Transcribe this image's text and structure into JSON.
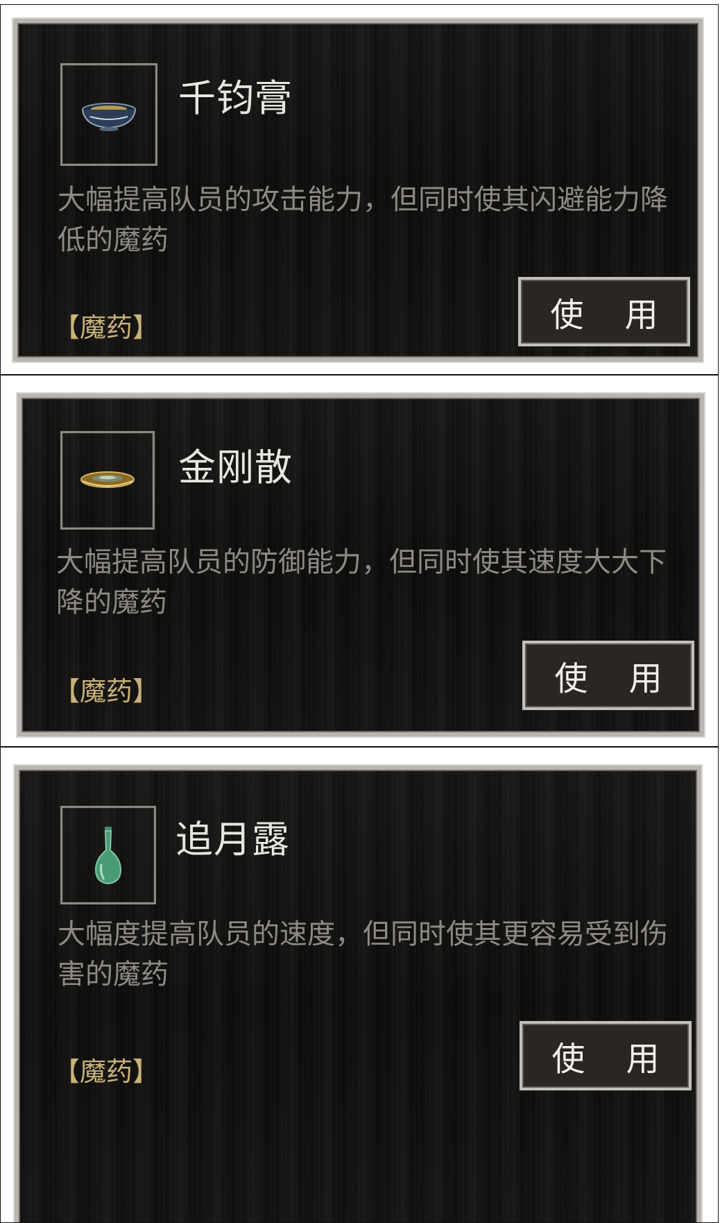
{
  "items": [
    {
      "name": "千钧膏",
      "description": "大幅提高队员的攻击能力，但同时使其闪避能力降低的魔药",
      "type_label": "【魔药】",
      "use_label": "使 用",
      "icon": "bowl-icon"
    },
    {
      "name": "金刚散",
      "description": "大幅提高队员的防御能力，但同时使其速度大大下降的魔药",
      "type_label": "【魔药】",
      "use_label": "使 用",
      "icon": "dish-icon"
    },
    {
      "name": "追月露",
      "description": "大幅度提高队员的速度，但同时使其更容易受到伤害的魔药",
      "type_label": "【魔药】",
      "use_label": "使 用",
      "icon": "vase-icon"
    }
  ]
}
